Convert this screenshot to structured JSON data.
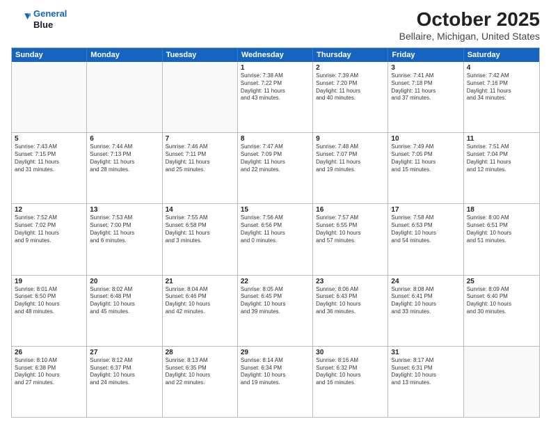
{
  "logo": {
    "line1": "General",
    "line2": "Blue"
  },
  "title": "October 2025",
  "subtitle": "Bellaire, Michigan, United States",
  "days": [
    "Sunday",
    "Monday",
    "Tuesday",
    "Wednesday",
    "Thursday",
    "Friday",
    "Saturday"
  ],
  "weeks": [
    [
      {
        "day": "",
        "text": ""
      },
      {
        "day": "",
        "text": ""
      },
      {
        "day": "",
        "text": ""
      },
      {
        "day": "1",
        "text": "Sunrise: 7:38 AM\nSunset: 7:22 PM\nDaylight: 11 hours\nand 43 minutes."
      },
      {
        "day": "2",
        "text": "Sunrise: 7:39 AM\nSunset: 7:20 PM\nDaylight: 11 hours\nand 40 minutes."
      },
      {
        "day": "3",
        "text": "Sunrise: 7:41 AM\nSunset: 7:18 PM\nDaylight: 11 hours\nand 37 minutes."
      },
      {
        "day": "4",
        "text": "Sunrise: 7:42 AM\nSunset: 7:16 PM\nDaylight: 11 hours\nand 34 minutes."
      }
    ],
    [
      {
        "day": "5",
        "text": "Sunrise: 7:43 AM\nSunset: 7:15 PM\nDaylight: 11 hours\nand 31 minutes."
      },
      {
        "day": "6",
        "text": "Sunrise: 7:44 AM\nSunset: 7:13 PM\nDaylight: 11 hours\nand 28 minutes."
      },
      {
        "day": "7",
        "text": "Sunrise: 7:46 AM\nSunset: 7:11 PM\nDaylight: 11 hours\nand 25 minutes."
      },
      {
        "day": "8",
        "text": "Sunrise: 7:47 AM\nSunset: 7:09 PM\nDaylight: 11 hours\nand 22 minutes."
      },
      {
        "day": "9",
        "text": "Sunrise: 7:48 AM\nSunset: 7:07 PM\nDaylight: 11 hours\nand 19 minutes."
      },
      {
        "day": "10",
        "text": "Sunrise: 7:49 AM\nSunset: 7:05 PM\nDaylight: 11 hours\nand 15 minutes."
      },
      {
        "day": "11",
        "text": "Sunrise: 7:51 AM\nSunset: 7:04 PM\nDaylight: 11 hours\nand 12 minutes."
      }
    ],
    [
      {
        "day": "12",
        "text": "Sunrise: 7:52 AM\nSunset: 7:02 PM\nDaylight: 11 hours\nand 9 minutes."
      },
      {
        "day": "13",
        "text": "Sunrise: 7:53 AM\nSunset: 7:00 PM\nDaylight: 11 hours\nand 6 minutes."
      },
      {
        "day": "14",
        "text": "Sunrise: 7:55 AM\nSunset: 6:58 PM\nDaylight: 11 hours\nand 3 minutes."
      },
      {
        "day": "15",
        "text": "Sunrise: 7:56 AM\nSunset: 6:56 PM\nDaylight: 11 hours\nand 0 minutes."
      },
      {
        "day": "16",
        "text": "Sunrise: 7:57 AM\nSunset: 6:55 PM\nDaylight: 10 hours\nand 57 minutes."
      },
      {
        "day": "17",
        "text": "Sunrise: 7:58 AM\nSunset: 6:53 PM\nDaylight: 10 hours\nand 54 minutes."
      },
      {
        "day": "18",
        "text": "Sunrise: 8:00 AM\nSunset: 6:51 PM\nDaylight: 10 hours\nand 51 minutes."
      }
    ],
    [
      {
        "day": "19",
        "text": "Sunrise: 8:01 AM\nSunset: 6:50 PM\nDaylight: 10 hours\nand 48 minutes."
      },
      {
        "day": "20",
        "text": "Sunrise: 8:02 AM\nSunset: 6:48 PM\nDaylight: 10 hours\nand 45 minutes."
      },
      {
        "day": "21",
        "text": "Sunrise: 8:04 AM\nSunset: 6:46 PM\nDaylight: 10 hours\nand 42 minutes."
      },
      {
        "day": "22",
        "text": "Sunrise: 8:05 AM\nSunset: 6:45 PM\nDaylight: 10 hours\nand 39 minutes."
      },
      {
        "day": "23",
        "text": "Sunrise: 8:06 AM\nSunset: 6:43 PM\nDaylight: 10 hours\nand 36 minutes."
      },
      {
        "day": "24",
        "text": "Sunrise: 8:08 AM\nSunset: 6:41 PM\nDaylight: 10 hours\nand 33 minutes."
      },
      {
        "day": "25",
        "text": "Sunrise: 8:09 AM\nSunset: 6:40 PM\nDaylight: 10 hours\nand 30 minutes."
      }
    ],
    [
      {
        "day": "26",
        "text": "Sunrise: 8:10 AM\nSunset: 6:38 PM\nDaylight: 10 hours\nand 27 minutes."
      },
      {
        "day": "27",
        "text": "Sunrise: 8:12 AM\nSunset: 6:37 PM\nDaylight: 10 hours\nand 24 minutes."
      },
      {
        "day": "28",
        "text": "Sunrise: 8:13 AM\nSunset: 6:35 PM\nDaylight: 10 hours\nand 22 minutes."
      },
      {
        "day": "29",
        "text": "Sunrise: 8:14 AM\nSunset: 6:34 PM\nDaylight: 10 hours\nand 19 minutes."
      },
      {
        "day": "30",
        "text": "Sunrise: 8:16 AM\nSunset: 6:32 PM\nDaylight: 10 hours\nand 16 minutes."
      },
      {
        "day": "31",
        "text": "Sunrise: 8:17 AM\nSunset: 6:31 PM\nDaylight: 10 hours\nand 13 minutes."
      },
      {
        "day": "",
        "text": ""
      }
    ]
  ]
}
